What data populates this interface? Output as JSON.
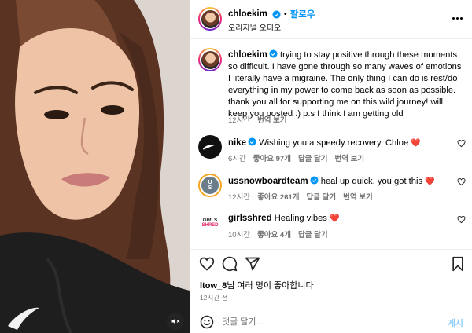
{
  "post": {
    "username": "chloekim",
    "follow_label": "팔로우",
    "dot": "•",
    "audio": "오리지널 오디오"
  },
  "caption": {
    "username": "chloekim",
    "text": "trying to stay positive through these moments so difficult. I have gone through so many waves of emotions I literally have a migraine. The only thing I can do is rest/do everything in my power to come back as soon as possible. thank you all for supporting me on this wild journey! will keep you posted :) p.s I think I am getting old",
    "time": "12시간",
    "translate": "번역 보기"
  },
  "comments": [
    {
      "username": "nike",
      "verified": true,
      "text": "Wishing you a speedy recovery, Chloe",
      "emoji": "❤️",
      "time": "6시간",
      "likes": "좋아요 97개",
      "reply": "답글 달기",
      "translate": "번역 보기",
      "avatar": "nike-logo"
    },
    {
      "username": "ussnowboardteam",
      "verified": true,
      "text": "heal up quick, you got this",
      "emoji": "❤️",
      "time": "12시간",
      "likes": "좋아요 261개",
      "reply": "답글 달기",
      "translate": "번역 보기",
      "avatar": "us-snowboard-logo"
    },
    {
      "username": "girlsshred",
      "verified": false,
      "text": "Healing vibes",
      "emoji": "❤️",
      "time": "10시간",
      "likes": "좋아요 4개",
      "reply": "답글 달기",
      "translate": "",
      "avatar": "girls-shred-logo",
      "avatar_text": [
        "GIRLS",
        "SHRED"
      ]
    }
  ],
  "likes_line": {
    "user": "ltow_8",
    "rest": "님 여러 명이 좋아합니다"
  },
  "post_time": "12시간 전",
  "composer": {
    "placeholder": "댓글 달기...",
    "post_label": "게시"
  },
  "icons": [
    "more-icon",
    "heart-icon",
    "comment-icon",
    "share-icon",
    "save-icon",
    "emoji-icon",
    "mute-icon",
    "verified-icon"
  ],
  "colors": {
    "accent": "#0095f6",
    "verified": "#0095f6",
    "muted": "#737373",
    "heart": "#e0245e"
  }
}
